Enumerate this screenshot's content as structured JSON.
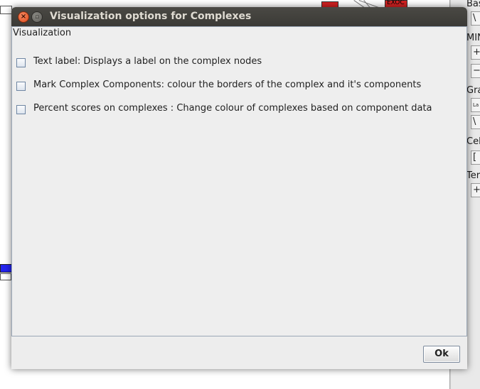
{
  "dialog": {
    "title": "Visualization options for Complexes",
    "close_glyph": "×",
    "minimize_glyph": "▫",
    "section_title": "Visualization",
    "options": [
      {
        "label": "Text label: Displays a label on the complex nodes",
        "checked": false
      },
      {
        "label": "Mark Complex Components: colour the borders of the complex and it's components",
        "checked": false
      },
      {
        "label": "Percent scores on complexes : Change colour of complexes based on component data",
        "checked": false
      }
    ],
    "ok_label": "Ok"
  },
  "background": {
    "right_panel_labels": [
      "Bas",
      "MIN",
      "Gra",
      "Cel",
      "Ter"
    ],
    "controls": [
      "\\",
      "+",
      "−",
      "La",
      "\\",
      "[",
      "+"
    ],
    "node_label": "EXOC"
  },
  "colors": {
    "titlebar": "#3f3e3a",
    "close_button": "#e45a2b",
    "dialog_bg": "#ededed",
    "panel_border": "#9aa6b6",
    "checkbox_border": "#6f86a3"
  }
}
